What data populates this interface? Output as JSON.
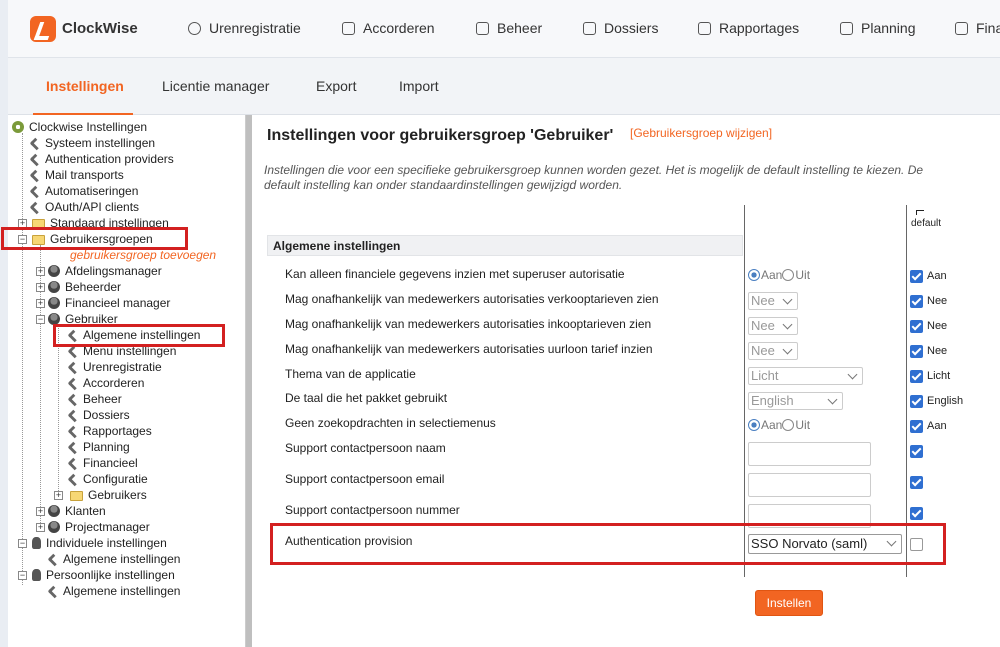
{
  "app": {
    "name": "ClockWise"
  },
  "topnav": [
    "Urenregistratie",
    "Accorderen",
    "Beheer",
    "Dossiers",
    "Rapportages",
    "Planning",
    "Fina"
  ],
  "subtabs": [
    "Instellingen",
    "Licentie manager",
    "Export",
    "Import"
  ],
  "tree": {
    "root": "Clockwise Instellingen",
    "items": [
      "Systeem instellingen",
      "Authentication providers",
      "Mail transports",
      "Automatiseringen",
      "OAuth/API clients",
      "Standaard instellingen",
      "Gebruikersgroepen"
    ],
    "add_group": "gebruikersgroep toevoegen",
    "groups": [
      "Afdelingsmanager",
      "Beheerder",
      "Financieel manager",
      "Gebruiker"
    ],
    "gebruiker_children": [
      "Algemene instellingen",
      "Menu instellingen",
      "Urenregistratie",
      "Accorderen",
      "Beheer",
      "Dossiers",
      "Rapportages",
      "Planning",
      "Financieel",
      "Configuratie",
      "Gebruikers"
    ],
    "more_groups": [
      "Klanten",
      "Projectmanager"
    ],
    "individual": "Individuele instellingen",
    "individual_child": "Algemene instellingen",
    "personal": "Persoonlijke instellingen",
    "personal_child": "Algemene instellingen"
  },
  "main": {
    "title": "Instellingen voor gebruikersgroep 'Gebruiker'",
    "change_link": "[Gebruikersgroep wijzigen]",
    "description": "Instellingen die voor een specifieke gebruikersgroep kunnen worden gezet. Het is mogelijk de default instelling te kiezen. De default instelling kan onder standaardinstellingen gewijzigd worden.",
    "default_label": "default",
    "section": "Algemene instellingen",
    "radio_yes": "Aan",
    "radio_no": "Uit",
    "rows": [
      {
        "label": "Kan alleen financiele gegevens inzien met superuser autorisatie",
        "default_text": "Aan"
      },
      {
        "label": "Mag onafhankelijk van medewerkers autorisaties verkooptarieven zien",
        "value": "Nee",
        "default_text": "Nee"
      },
      {
        "label": "Mag onafhankelijk van medewerkers autorisaties inkooptarieven zien",
        "value": "Nee",
        "default_text": "Nee"
      },
      {
        "label": "Mag onafhankelijk van medewerkers autorisaties uurloon tarief inzien",
        "value": "Nee",
        "default_text": "Nee"
      },
      {
        "label": "Thema van de applicatie",
        "value": "Licht",
        "default_text": "Licht"
      },
      {
        "label": "De taal die het pakket gebruikt",
        "value": "English",
        "default_text": "English"
      },
      {
        "label": "Geen zoekopdrachten in selectiemenus",
        "default_text": "Aan"
      },
      {
        "label": "Support contactpersoon naam"
      },
      {
        "label": "Support contactpersoon email"
      },
      {
        "label": "Support contactpersoon nummer"
      },
      {
        "label": "Authentication provision",
        "value": "SSO Norvato (saml)"
      }
    ],
    "submit": "Instellen"
  },
  "colors": {
    "accent": "#f26522",
    "highlight": "#d32020",
    "checkbox": "#2f6fd1"
  }
}
